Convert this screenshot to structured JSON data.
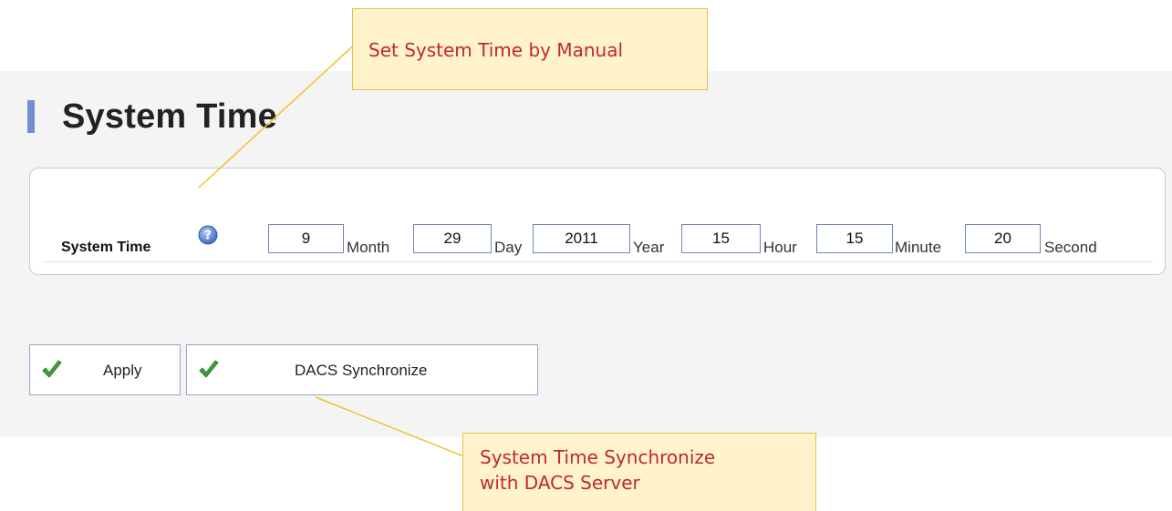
{
  "page": {
    "title": "System Time"
  },
  "system_time": {
    "row_label": "System Time",
    "help_icon": "question-circle-icon",
    "fields": [
      {
        "key": "month",
        "value": "9",
        "unit": "Month"
      },
      {
        "key": "day",
        "value": "29",
        "unit": "Day"
      },
      {
        "key": "year",
        "value": "2011",
        "unit": "Year"
      },
      {
        "key": "hour",
        "value": "15",
        "unit": "Hour"
      },
      {
        "key": "minute",
        "value": "15",
        "unit": "Minute"
      },
      {
        "key": "second",
        "value": "20",
        "unit": "Second"
      }
    ]
  },
  "actions": {
    "apply_label": "Apply",
    "dacs_sync_label": "DACS Synchronize",
    "button_icon": "green-check-icon"
  },
  "annotations": {
    "manual": "Set System Time by Manual",
    "dacs_line1": "System Time Synchronize",
    "dacs_line2": "with DACS Server"
  },
  "colors": {
    "title_accent": "#6f8fd0",
    "callout_text": "#c0282d",
    "callout_fill": "#fff3cc",
    "callout_border": "#e6c04e",
    "check_green": "#3fa33a"
  }
}
